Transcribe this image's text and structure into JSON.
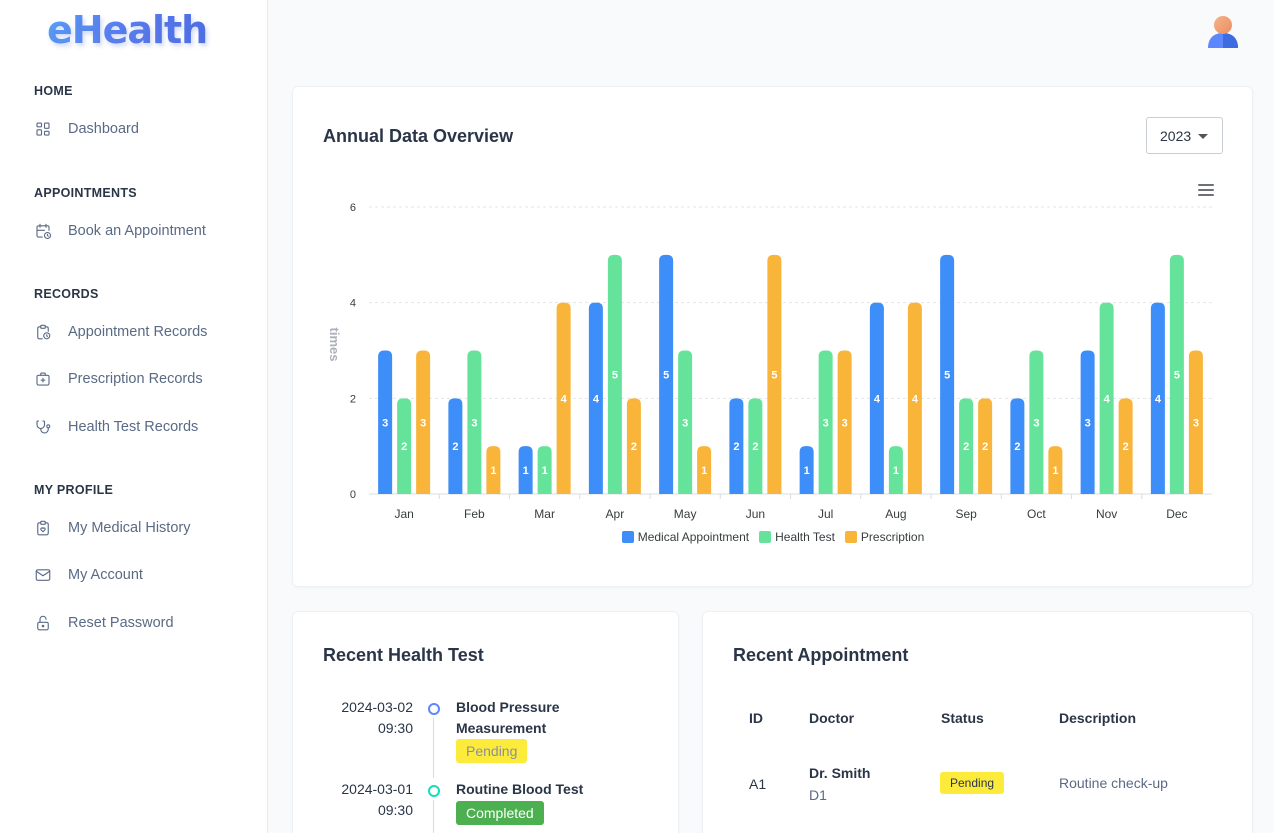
{
  "app": {
    "logo": "eHealth"
  },
  "sidebar": {
    "sections": [
      {
        "title": "HOME",
        "items": [
          {
            "label": "Dashboard",
            "icon": "dashboard-icon"
          }
        ]
      },
      {
        "title": "APPOINTMENTS",
        "items": [
          {
            "label": "Book an Appointment",
            "icon": "calendar-clock-icon"
          }
        ]
      },
      {
        "title": "RECORDS",
        "items": [
          {
            "label": "Appointment Records",
            "icon": "clipboard-clock-icon"
          },
          {
            "label": "Prescription Records",
            "icon": "medical-bag-icon"
          },
          {
            "label": "Health Test Records",
            "icon": "stethoscope-icon"
          }
        ]
      },
      {
        "title": "MY PROFILE",
        "items": [
          {
            "label": "My Medical History",
            "icon": "clipboard-heart-icon"
          },
          {
            "label": "My Account",
            "icon": "mail-icon"
          },
          {
            "label": "Reset Password",
            "icon": "lock-open-icon"
          }
        ]
      }
    ]
  },
  "overview": {
    "title": "Annual Data Overview",
    "year": "2023"
  },
  "chart_data": {
    "type": "bar",
    "categories": [
      "Jan",
      "Feb",
      "Mar",
      "Apr",
      "May",
      "Jun",
      "Jul",
      "Aug",
      "Sep",
      "Oct",
      "Nov",
      "Dec"
    ],
    "series": [
      {
        "name": "Medical Appointment",
        "color": "#3d8ef8",
        "values": [
          3,
          2,
          1,
          4,
          5,
          2,
          1,
          4,
          5,
          2,
          3,
          4
        ]
      },
      {
        "name": "Health Test",
        "color": "#66e39a",
        "values": [
          2,
          3,
          1,
          5,
          3,
          2,
          3,
          1,
          2,
          3,
          4,
          5
        ]
      },
      {
        "name": "Prescription",
        "color": "#f8b53a",
        "values": [
          3,
          1,
          4,
          2,
          1,
          5,
          3,
          4,
          2,
          1,
          2,
          3
        ]
      }
    ],
    "ylabel": "times",
    "ylim": [
      0,
      6
    ],
    "yticks": [
      0,
      2,
      4,
      6
    ],
    "grid": true,
    "legend": "bottom",
    "data_labels": true
  },
  "health_tests": {
    "title": "Recent Health Test",
    "items": [
      {
        "date": "2024-03-02",
        "time": "09:30",
        "name": "Blood Pressure Measurement",
        "status": "Pending",
        "dot_color": "#5d87ff"
      },
      {
        "date": "2024-03-01",
        "time": "09:30",
        "name": "Routine Blood Test",
        "status": "Completed",
        "dot_color": "#13deb9"
      }
    ]
  },
  "appointments": {
    "title": "Recent Appointment",
    "columns": [
      "ID",
      "Doctor",
      "Status",
      "Description"
    ],
    "rows": [
      {
        "id": "A1",
        "doctor": "Dr. Smith",
        "doctor_id": "D1",
        "status": "Pending",
        "description": "Routine check-up"
      }
    ]
  }
}
